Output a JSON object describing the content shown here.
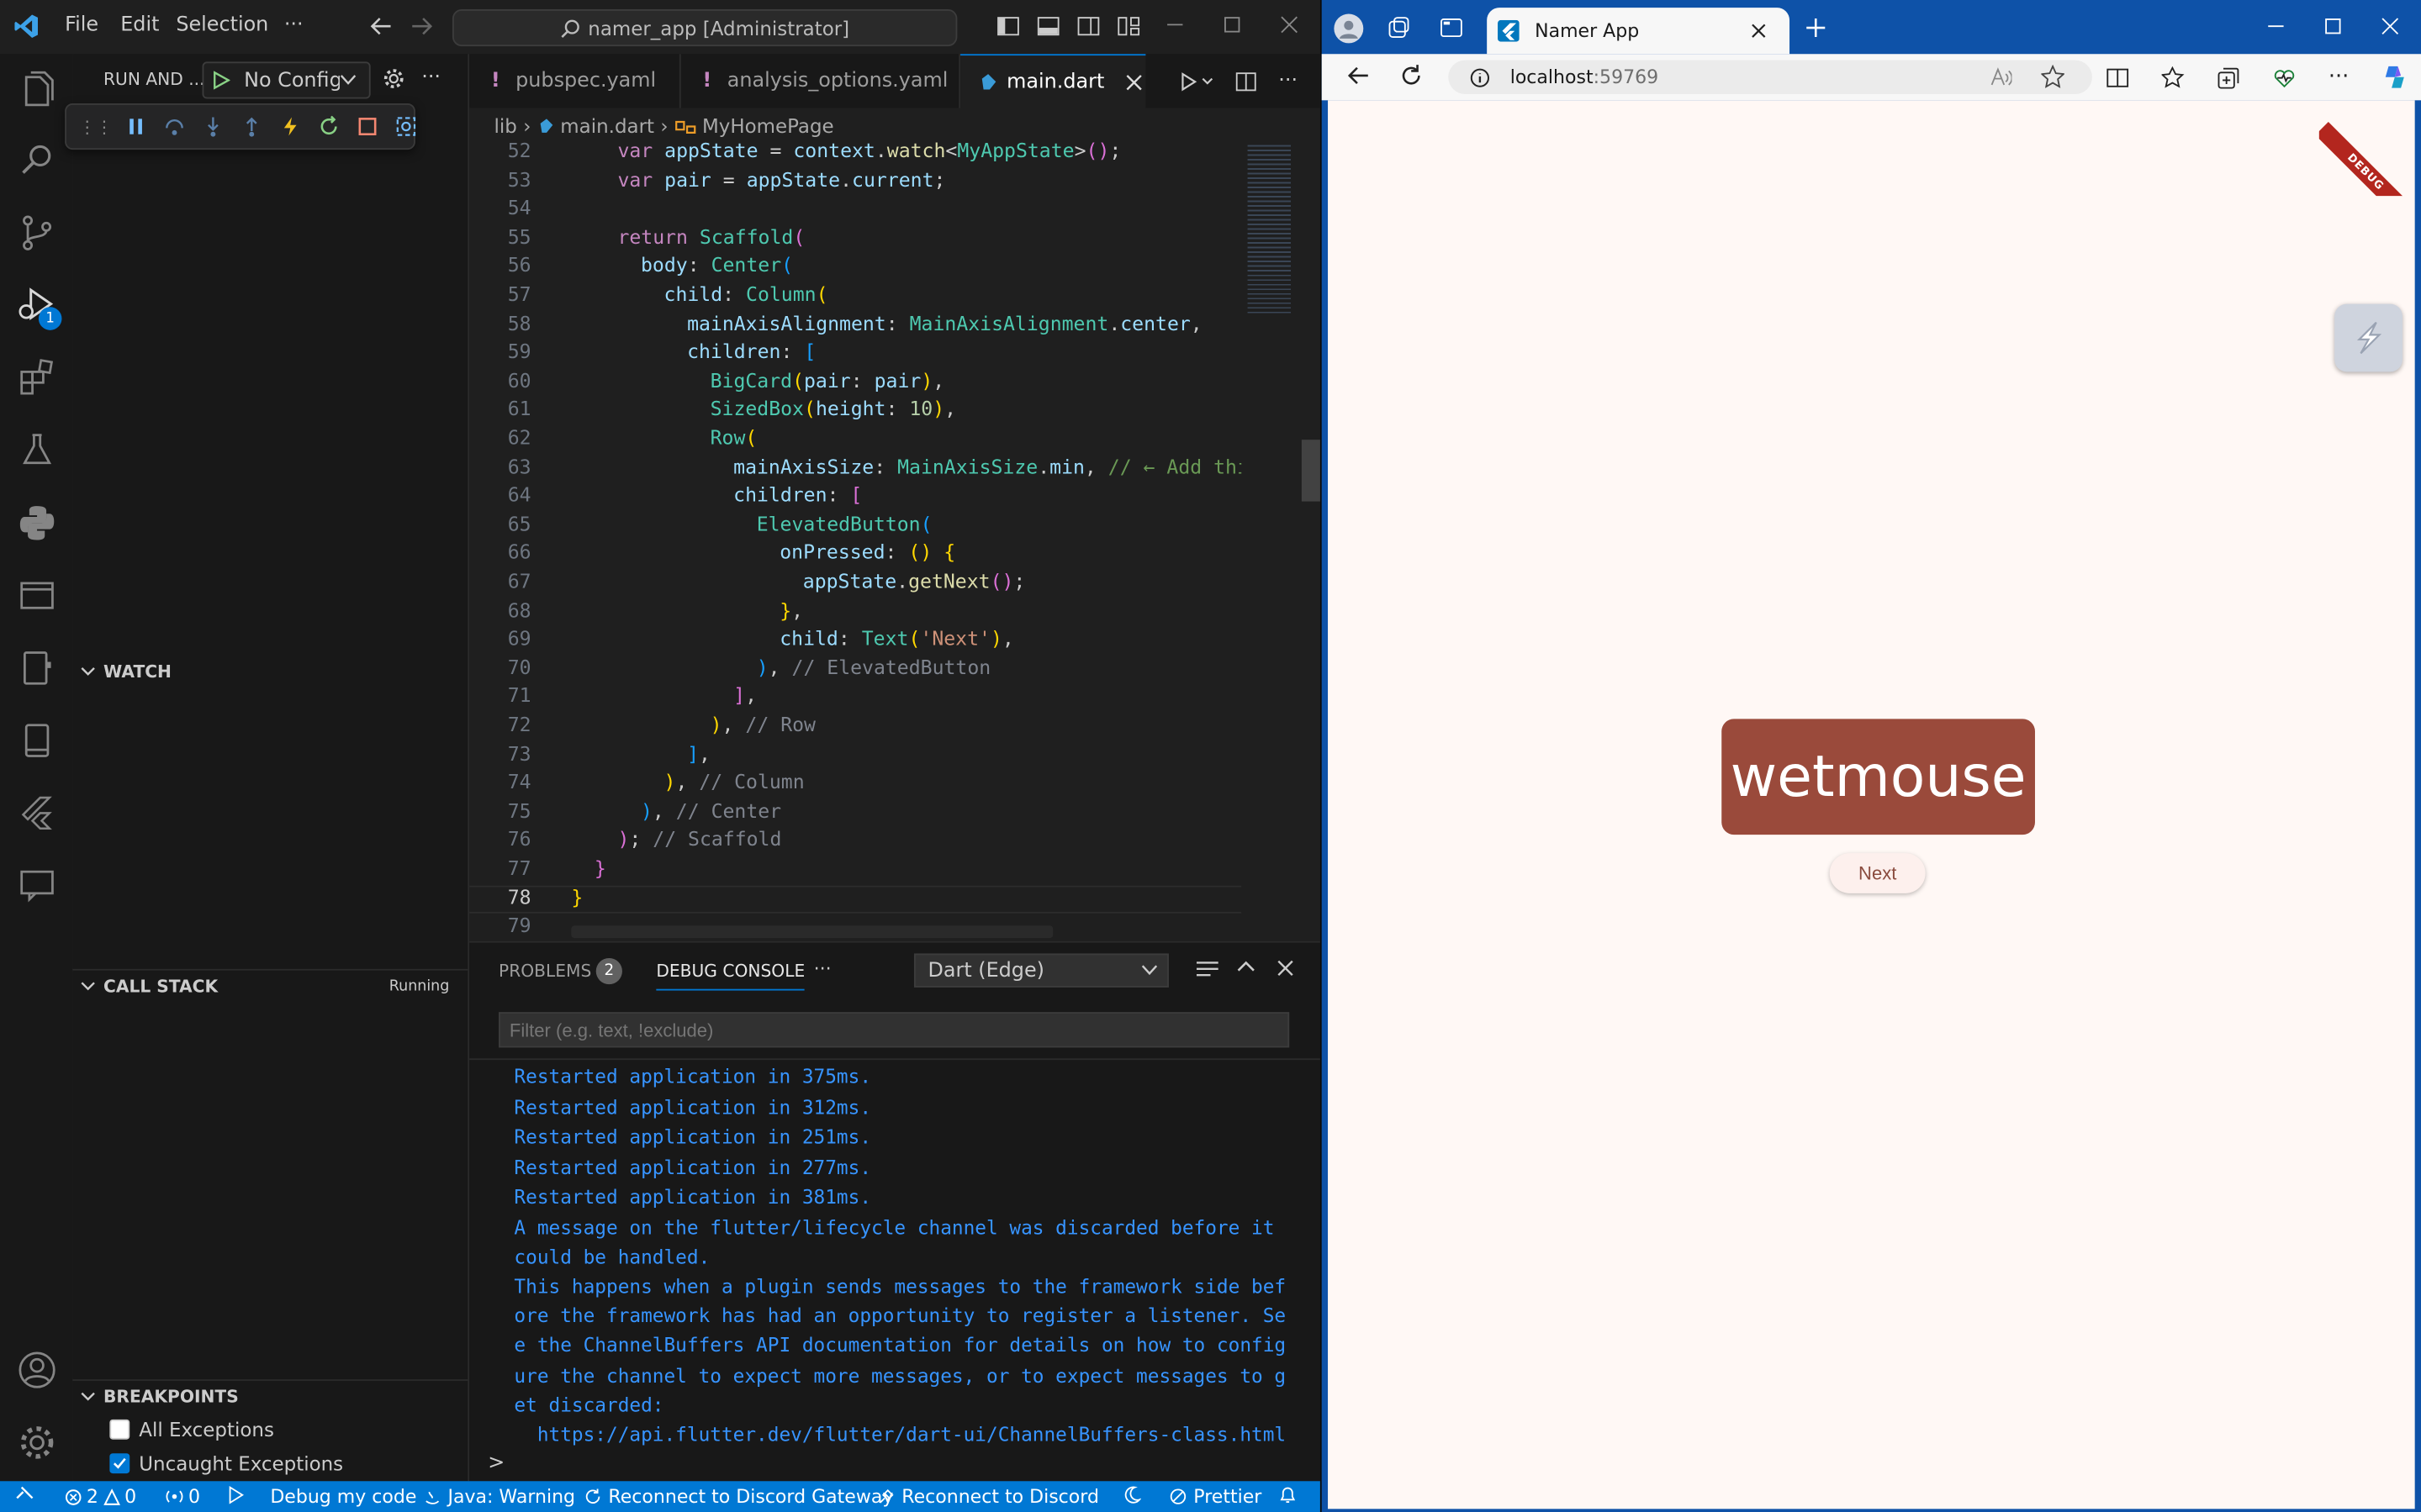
{
  "vscode": {
    "menu": {
      "file": "File",
      "edit": "Edit",
      "selection": "Selection",
      "more": "···"
    },
    "command_center": "namer_app [Administrator]",
    "sidebar": {
      "run_title": "RUN AND ...",
      "config": "No Configi",
      "watch": "WATCH",
      "call_stack": "CALL STACK",
      "call_stack_status": "Running",
      "breakpoints": "BREAKPOINTS",
      "bp_all": "All Exceptions",
      "bp_uncaught": "Uncaught Exceptions"
    },
    "tabs": [
      {
        "label": "pubspec.yaml",
        "marker": "!"
      },
      {
        "label": "analysis_options.yaml",
        "marker": "!"
      },
      {
        "label": "main.dart",
        "marker": ""
      }
    ],
    "breadcrumb": {
      "folder": "lib",
      "file": "main.dart",
      "symbol": "MyHomePage"
    },
    "line_numbers": [
      "52",
      "53",
      "54",
      "55",
      "56",
      "57",
      "58",
      "59",
      "60",
      "61",
      "62",
      "63",
      "64",
      "65",
      "66",
      "67",
      "68",
      "69",
      "70",
      "71",
      "72",
      "73",
      "74",
      "75",
      "76",
      "77",
      "78",
      "79"
    ],
    "code_lines": [
      "var appState = context.watch<MyAppState>();",
      "var pair = appState.current;",
      "",
      "return Scaffold(",
      "body: Center(",
      "child: Column(",
      "mainAxisAlignment: MainAxisAlignment.center,",
      "children: [",
      "BigCard(pair: pair),",
      "SizedBox(height: 10),",
      "Row(",
      "mainAxisSize: MainAxisSize.min, // ← Add thi",
      "children: [",
      "ElevatedButton(",
      "onPressed: () {",
      "appState.getNext();",
      "},",
      "child: Text('Next'),",
      "), // ElevatedButton",
      "],",
      "), // Row",
      "],",
      "), // Column",
      "), // Center",
      "); // Scaffold",
      "}",
      "}",
      ""
    ],
    "panel": {
      "problems": "PROBLEMS",
      "problems_count": "2",
      "debug_console": "DEBUG CONSOLE",
      "more": "···",
      "dropdown": "Dart (Edge)",
      "filter_placeholder": "Filter (e.g. text, !exclude)",
      "output": [
        "Restarted application in 375ms.",
        "Restarted application in 312ms.",
        "Restarted application in 251ms.",
        "Restarted application in 277ms.",
        "Restarted application in 381ms.",
        "A message on the flutter/lifecycle channel was discarded before it",
        "could be handled.",
        "This happens when a plugin sends messages to the framework side bef",
        "ore the framework has had an opportunity to register a listener. Se",
        "e the ChannelBuffers API documentation for details on how to config",
        "ure the channel to expect more messages, or to expect messages to g",
        "et discarded:",
        "  https://api.flutter.dev/flutter/dart-ui/ChannelBuffers-class.html"
      ],
      "prompt": ">"
    },
    "status": {
      "errors": "2",
      "warnings": "0",
      "ports": "0",
      "debug": "Debug my code",
      "java": "Java: Warning",
      "discord_gw": "Reconnect to Discord Gateway",
      "discord": "Reconnect to Discord",
      "prettier": "Prettier"
    },
    "debug_badge": "1",
    "colors": {
      "accent": "#0078d4",
      "status_bar": "#0078d4"
    }
  },
  "browser": {
    "tab_title": "Namer App",
    "url": "localhost",
    "port": ":59769",
    "banner": "DEBUG",
    "app": {
      "word": "wetmouse",
      "next_label": "Next",
      "card_color": "#9a4a3b",
      "page_bg": "#fff8f5"
    }
  }
}
